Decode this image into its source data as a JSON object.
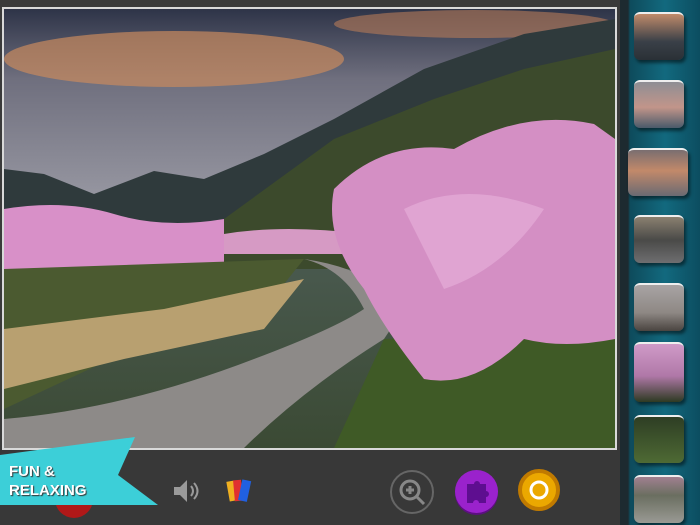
{
  "banner": {
    "line1": "FUN &",
    "line2": "RELAXING",
    "color": "#3ccfd8"
  },
  "toolbar": {
    "buttons": [
      {
        "name": "record-button",
        "icon": "red-circle"
      },
      {
        "name": "sound-button",
        "icon": "speaker-icon"
      },
      {
        "name": "backgrounds-button",
        "icon": "cards-icon"
      },
      {
        "name": "zoom-button",
        "icon": "zoom-in-icon"
      },
      {
        "name": "pieces-button",
        "icon": "puzzle-piece-icon",
        "color": "#8a1fc0"
      },
      {
        "name": "coins-button",
        "icon": "coin-icon",
        "color": "#e8a800"
      }
    ]
  },
  "tray": {
    "piece_count": 8,
    "color": "#0f5a6e"
  }
}
